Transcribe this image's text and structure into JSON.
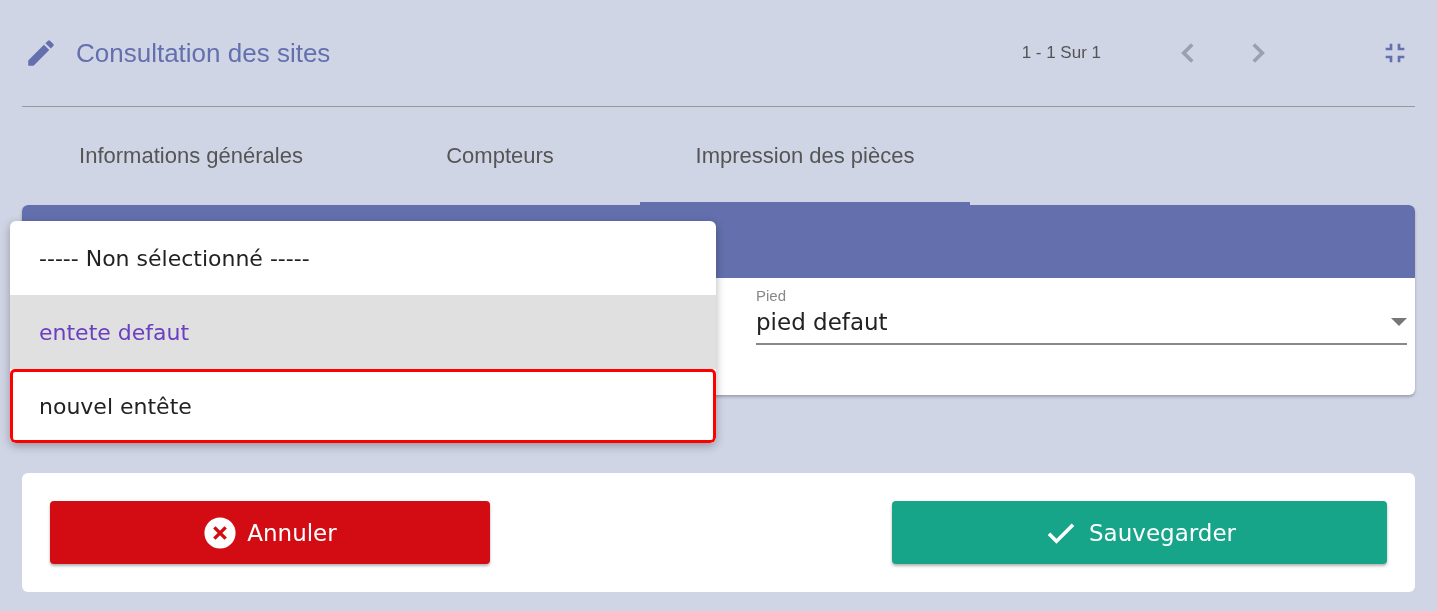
{
  "header": {
    "title": "Consultation des sites",
    "pager": "1 - 1 Sur 1",
    "prev_disabled": true,
    "next_disabled": true
  },
  "tabs": [
    {
      "label": "Informations générales",
      "selected": false
    },
    {
      "label": "Compteurs",
      "selected": false
    },
    {
      "label": "Impression des pièces",
      "selected": true
    }
  ],
  "footer_field": {
    "label": "Pied",
    "value": "pied defaut"
  },
  "dropdown": {
    "options": [
      {
        "label": "----- Non sélectionné -----",
        "selected": false,
        "outlined": false
      },
      {
        "label": "entete defaut",
        "selected": true,
        "outlined": false
      },
      {
        "label": "nouvel entête",
        "selected": false,
        "outlined": true
      }
    ]
  },
  "buttons": [
    {
      "kind": "cancel",
      "label": "Annuler"
    },
    {
      "kind": "save",
      "label": "Sauvegarder"
    }
  ]
}
